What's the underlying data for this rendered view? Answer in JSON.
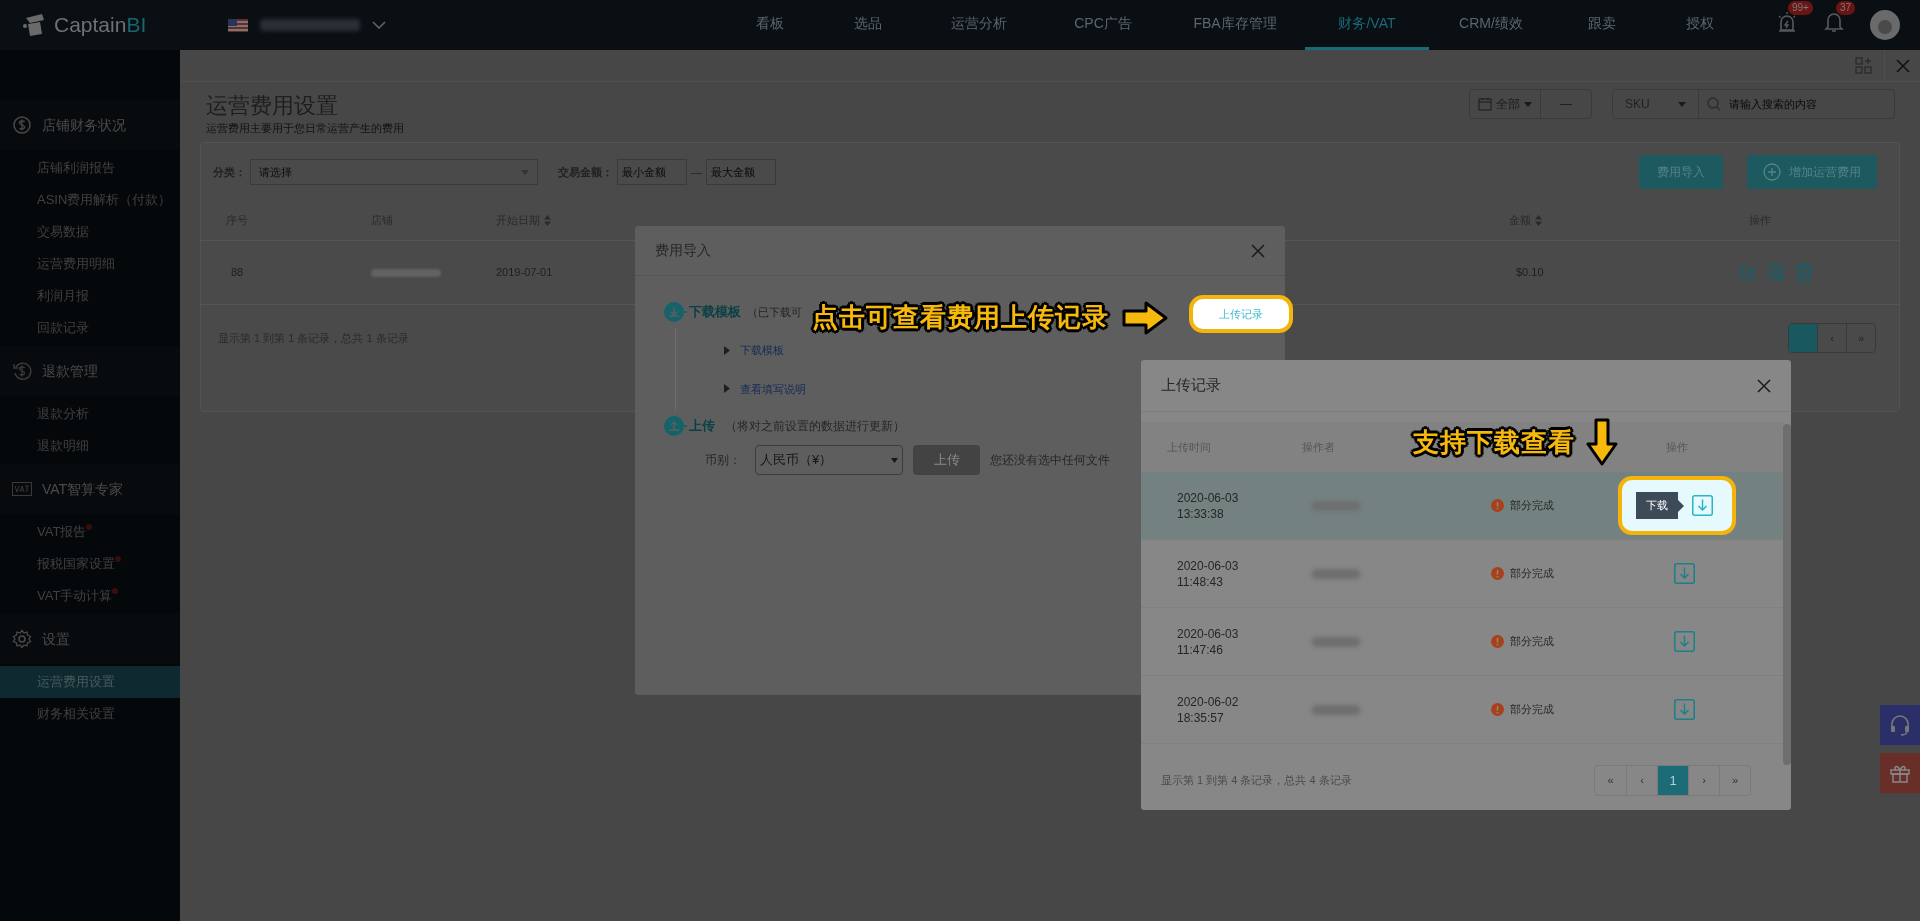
{
  "topbar": {
    "logo_word": "Captain",
    "logo_accent": "BI",
    "nav": [
      {
        "label": "看板",
        "selected": false
      },
      {
        "label": "选品",
        "selected": false
      },
      {
        "label": "运营分析",
        "selected": false
      },
      {
        "label": "CPC广告",
        "selected": false
      },
      {
        "label": "FBA库存管理",
        "selected": false
      },
      {
        "label": "财务/VAT",
        "selected": true
      },
      {
        "label": "CRM/绩效",
        "selected": false
      },
      {
        "label": "跟卖",
        "selected": false
      },
      {
        "label": "授权",
        "selected": false
      }
    ],
    "alert_count": "99+",
    "notification_count": "37"
  },
  "sidebar": {
    "groups": [
      {
        "title": "店铺财务状况",
        "items": [
          {
            "label": "店铺利润报告",
            "selected": false,
            "dot": false
          },
          {
            "label": "ASIN费用解析（付款）",
            "selected": false,
            "dot": false
          },
          {
            "label": "交易数据",
            "selected": false,
            "dot": false
          },
          {
            "label": "运营费用明细",
            "selected": false,
            "dot": false
          },
          {
            "label": "利润月报",
            "selected": false,
            "dot": false
          },
          {
            "label": "回款记录",
            "selected": false,
            "dot": false
          }
        ]
      },
      {
        "title": "退款管理",
        "items": [
          {
            "label": "退款分析",
            "selected": false,
            "dot": false
          },
          {
            "label": "退款明细",
            "selected": false,
            "dot": false
          }
        ]
      },
      {
        "title": "VAT智算专家",
        "items": [
          {
            "label": "VAT报告",
            "selected": false,
            "dot": true
          },
          {
            "label": "报税国家设置",
            "selected": false,
            "dot": true
          },
          {
            "label": "VAT手动计算",
            "selected": false,
            "dot": true
          }
        ]
      },
      {
        "title": "设置",
        "items": [
          {
            "label": "运营费用设置",
            "selected": true,
            "dot": false
          },
          {
            "label": "财务相关设置",
            "selected": false,
            "dot": false
          }
        ]
      }
    ]
  },
  "page": {
    "title": "运营费用设置",
    "subtitle": "运营费用主要用于您日常运营产生的费用",
    "date_filter": "全部",
    "date_separator": "—",
    "search_type": "SKU",
    "search_placeholder": "请输入搜索的内容",
    "filters": {
      "category_label": "分类：",
      "category_placeholder": "请选择",
      "amount_label": "交易金额：",
      "min_placeholder": "最小金额",
      "separator": "—",
      "max_placeholder": "最大金额"
    },
    "buttons": [
      "费用导入",
      "增加运营费用"
    ],
    "table": {
      "columns": [
        {
          "label": "序号",
          "sortable": false
        },
        {
          "label": "店铺",
          "sortable": false
        },
        {
          "label": "开始日期",
          "sortable": true
        },
        {
          "label": "金额",
          "sortable": true
        },
        {
          "label": "操作",
          "sortable": false
        }
      ],
      "rows": [
        {
          "index": "88",
          "start_date": "2019-07-01",
          "amount": "$0.10"
        }
      ]
    },
    "summary": "显示第 1 到第 1 条记录，总共 1 条记录",
    "pagination": [
      {
        "label": "‹",
        "selected": false
      },
      {
        "label": "»",
        "selected": false
      }
    ]
  },
  "import_dialog": {
    "title": "费用导入",
    "download_step": {
      "title": "下载模板",
      "note": "（已下载可"
    },
    "links": [
      "下载模板",
      "查看填写说明"
    ],
    "upload_step": {
      "title": "上传",
      "note": "（将对之前设置的数据进行更新）"
    },
    "currency_label": "币别：",
    "currency": "人民币（¥）",
    "upload_button": {
      "label": "上传",
      "disabled": true
    },
    "file_status": "您还没有选中任何文件",
    "records_button": "上传记录"
  },
  "records_dialog": {
    "title": "上传记录",
    "columns": [
      {
        "label": "上传时间"
      },
      {
        "label": "操作者"
      },
      {
        "label": "操作"
      }
    ],
    "rows": [
      {
        "date": "2020-06-03",
        "time": "13:33:38",
        "status": "部分完成",
        "selected": true,
        "tooltip": "下载"
      },
      {
        "date": "2020-06-03",
        "time": "11:48:43",
        "status": "部分完成",
        "selected": false
      },
      {
        "date": "2020-06-03",
        "time": "11:47:46",
        "status": "部分完成",
        "selected": false
      },
      {
        "date": "2020-06-02",
        "time": "18:35:57",
        "status": "部分完成",
        "selected": false
      }
    ],
    "summary": "显示第 1 到第 4 条记录，总共 4 条记录",
    "pagination": [
      {
        "label": "«",
        "selected": false
      },
      {
        "label": "‹",
        "selected": false
      },
      {
        "label": "1",
        "selected": true
      },
      {
        "label": "›",
        "selected": false
      },
      {
        "label": "»",
        "selected": false
      }
    ]
  },
  "callouts": [
    "点击可查看费用上传记录",
    "支持下载查看"
  ]
}
